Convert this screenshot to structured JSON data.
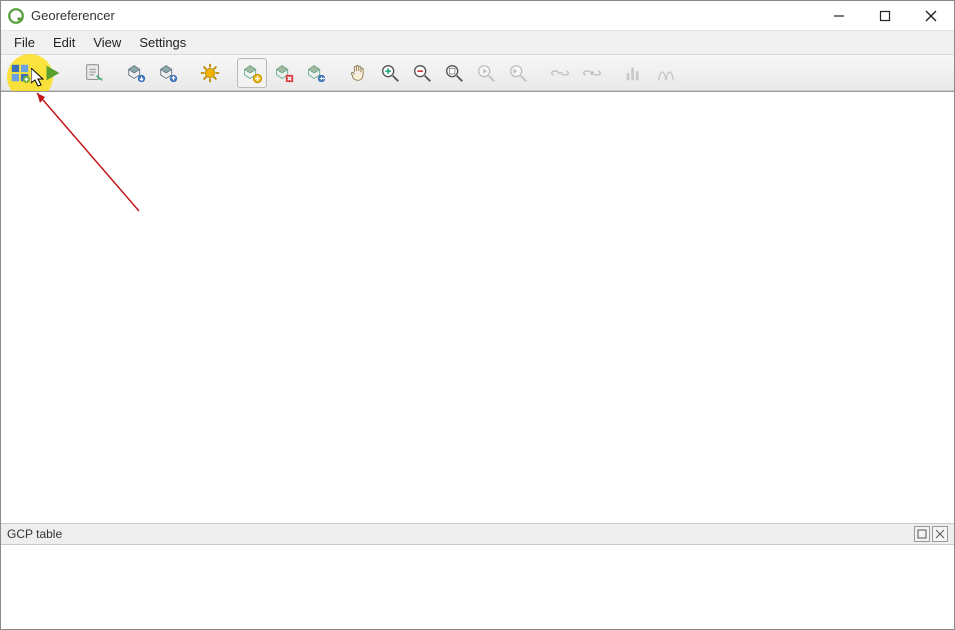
{
  "window": {
    "title": "Georeferencer"
  },
  "menubar": {
    "items": [
      "File",
      "Edit",
      "View",
      "Settings"
    ]
  },
  "toolbar": {
    "buttons": [
      {
        "name": "open-raster-button",
        "interactable": true
      },
      {
        "name": "start-georef-button",
        "interactable": true
      },
      {
        "name": "generate-script-button",
        "interactable": true
      },
      {
        "name": "load-gcp-button",
        "interactable": true
      },
      {
        "name": "save-gcp-button",
        "interactable": true
      },
      {
        "name": "transformation-settings-button",
        "interactable": true
      },
      {
        "name": "add-point-button",
        "interactable": true
      },
      {
        "name": "delete-point-button",
        "interactable": true
      },
      {
        "name": "move-point-button",
        "interactable": true
      },
      {
        "name": "pan-button",
        "interactable": true
      },
      {
        "name": "zoom-in-button",
        "interactable": true
      },
      {
        "name": "zoom-out-button",
        "interactable": true
      },
      {
        "name": "zoom-layer-button",
        "interactable": true
      },
      {
        "name": "zoom-last-button",
        "interactable": false
      },
      {
        "name": "zoom-next-button",
        "interactable": false
      },
      {
        "name": "link-georef-button",
        "interactable": false
      },
      {
        "name": "link-qgis-button",
        "interactable": false
      },
      {
        "name": "histogram-button",
        "interactable": false
      },
      {
        "name": "stretch-button",
        "interactable": false
      }
    ]
  },
  "panel": {
    "title": "GCP table"
  },
  "annotation": {
    "highlight": true,
    "arrow": true
  }
}
